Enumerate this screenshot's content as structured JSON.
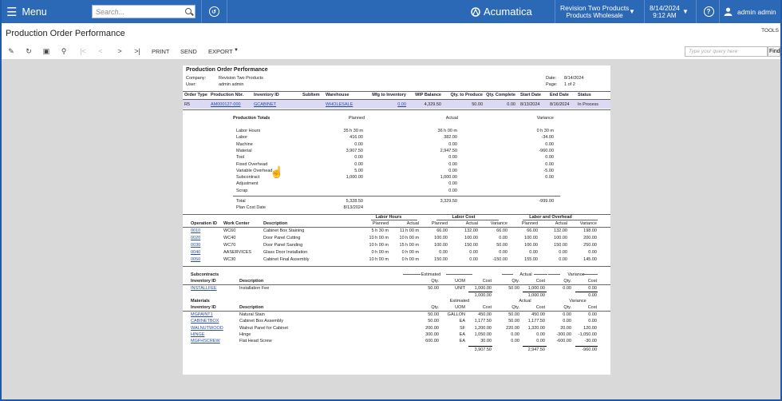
{
  "topbar": {
    "menu": "Menu",
    "search_placeholder": "Search...",
    "logo": "Acumatica",
    "company_line1": "Revision Two Products",
    "company_line2": "Products Wholesale",
    "date": "8/14/2024",
    "time": "9:12 AM",
    "user": "admin admin"
  },
  "page": {
    "title": "Production Order Performance",
    "tools": "TOOLS"
  },
  "toolbar": {
    "print": "PRINT",
    "send": "SEND",
    "export": "EXPORT",
    "query_placeholder": "Type your query here",
    "find": "Find"
  },
  "report": {
    "title": "Production Order Performance",
    "company_label": "Company:",
    "company": "Revision Two Products",
    "user_label": "User:",
    "user": "admin admin",
    "date_label": "Date:",
    "date": "8/14/2024",
    "page_label": "Page:",
    "page": "1 of 2",
    "order_headers": [
      "Order Type",
      "Production Nbr.",
      "Inventory ID",
      "SubItem",
      "Warehouse",
      "Mfg to Inventory",
      "WIP Balance",
      "Qty. to Produce",
      "Qty. Complete",
      "Start Date",
      "End Date",
      "Status"
    ],
    "order": [
      "R5",
      "AM000127-000",
      "GCABINET",
      "",
      "WHOLESALE",
      "0.00",
      "4,329.50",
      "50.00",
      "0.00",
      "8/13/2024",
      "8/16/2024",
      "In Process"
    ],
    "totals_title": "Production Totals",
    "totals_planned": "Planned",
    "totals_actual": "Actual",
    "totals_variance": "Variance",
    "totals": [
      [
        "Labor Hours",
        "35 h 30 m",
        "36 h 00 m",
        "0 h 30 m"
      ],
      [
        "Labor",
        "416.00",
        "382.00",
        "-34.00"
      ],
      [
        "Machine",
        "0.00",
        "0.00",
        "0.00"
      ],
      [
        "Material",
        "3,907.50",
        "2,947.50",
        "-960.00"
      ],
      [
        "Tool",
        "0.00",
        "0.00",
        "0.00"
      ],
      [
        "Fixed Overhead",
        "0.00",
        "0.00",
        "0.00"
      ],
      [
        "Variable Overhead",
        "5.00",
        "0.00",
        "-5.00"
      ],
      [
        "Subcontract",
        "1,000.00",
        "1,000.00",
        "0.00"
      ],
      [
        "Adjustment",
        "",
        "0.00",
        ""
      ],
      [
        "Scrap",
        "",
        "0.00",
        ""
      ]
    ],
    "total_label": "Total",
    "total_planned": "5,328.50",
    "total_actual": "3,329.50",
    "total_variance": "-999.00",
    "plan_cost_label": "Plan Cost Date",
    "plan_cost_date": "8/13/2024",
    "ops_groups": [
      "Labor Hours",
      "Labor Cost",
      "Labor and Overhead"
    ],
    "ops_headers": [
      "Operation ID",
      "Work Center",
      "Description",
      "Planned",
      "Actual",
      "Planned",
      "Actual",
      "Variance",
      "Planned",
      "Actual",
      "Variance"
    ],
    "ops": [
      [
        "0010",
        "WC60",
        "Cabinet Box Staining",
        "5 h 30 m",
        "11 h 00 m",
        "66.00",
        "132.00",
        "66.00",
        "66.00",
        "132.00",
        "198.00"
      ],
      [
        "0020",
        "WC40",
        "Door Panel Cutting",
        "10 h 00 m",
        "10 h 00 m",
        "100.00",
        "100.00",
        "0.00",
        "100.00",
        "100.00",
        "200.00"
      ],
      [
        "0030",
        "WC70",
        "Door Panel Sanding",
        "10 h 00 m",
        "15 h 00 m",
        "100.00",
        "150.00",
        "50.00",
        "100.00",
        "150.00",
        "250.00"
      ],
      [
        "0040",
        "AASERVICES",
        "Glass Door Installation",
        "0 h 00 m",
        "0 h 00 m",
        "0.00",
        "0.00",
        "0.00",
        "0.00",
        "0.00",
        "0.00"
      ],
      [
        "0050",
        "WC30",
        "Cabinet Final Assembly",
        "10 h 00 m",
        "0 h 00 m",
        "150.00",
        "0.00",
        "-150.00",
        "155.00",
        "0.00",
        "145.00"
      ]
    ],
    "sub_title": "Subcontracts",
    "sub_groups": [
      "Estimated",
      "Actual",
      "Variance"
    ],
    "sub_headers": [
      "Inventory ID",
      "Description",
      "Qty.",
      "UOM",
      "Cost",
      "Qty.",
      "Cost",
      "Qty.",
      "Cost"
    ],
    "sub_rows": [
      [
        "INSTALLFEE",
        "Installation Fee",
        "50.00",
        "UNIT",
        "1,000.00",
        "50.00",
        "1,000.00",
        "0.00",
        "0.00"
      ]
    ],
    "sub_totals": [
      "1,000.00",
      "1,000.00",
      "0.00"
    ],
    "mat_title": "Materials",
    "mat_groups": [
      "Estimated",
      "Actual",
      "Variance"
    ],
    "mat_headers": [
      "Inventory ID",
      "Description",
      "Qty.",
      "UOM",
      "Cost",
      "Qty.",
      "Cost",
      "Qty.",
      "Cost"
    ],
    "mat_rows": [
      [
        "MGPAINT1",
        "Natural Stain",
        "50.00",
        "GALLON",
        "450.00",
        "50.00",
        "450.00",
        "0.00",
        "0.00"
      ],
      [
        "CABINETBOX",
        "Cabinet Box Assembly",
        "50.00",
        "EA",
        "1,177.50",
        "50.00",
        "1,177.50",
        "0.00",
        "0.00"
      ],
      [
        "WALNUTWOOD",
        "Walnut Panel for Cabinet",
        "200.00",
        "SF",
        "1,200.00",
        "220.00",
        "1,320.00",
        "20.00",
        "120.00"
      ],
      [
        "HINGE",
        "Hinge",
        "300.00",
        "EA",
        "1,050.00",
        "0.00",
        "0.00",
        "-300.00",
        "-1,050.00"
      ],
      [
        "MGFHSCREW",
        "Flat Head Screw",
        "600.00",
        "EA",
        "30.00",
        "0.00",
        "0.00",
        "-600.00",
        "-30.00"
      ]
    ],
    "mat_totals": [
      "3,907.50",
      "2,947.50",
      "-960.00"
    ]
  }
}
